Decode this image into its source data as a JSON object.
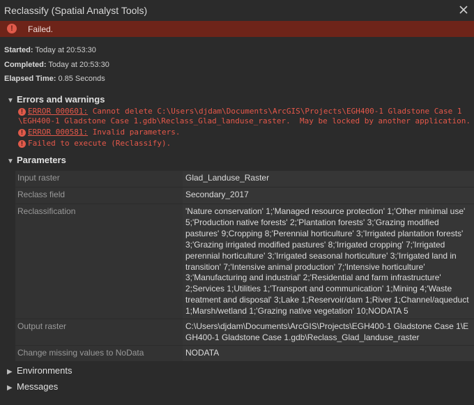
{
  "window": {
    "title": "Reclassify (Spatial Analyst Tools)"
  },
  "status": {
    "text": "Failed."
  },
  "info": {
    "started_label": "Started:",
    "started_value": "Today at 20:53:30",
    "completed_label": "Completed:",
    "completed_value": "Today at 20:53:30",
    "elapsed_label": "Elapsed Time:",
    "elapsed_value": "0.85 Seconds"
  },
  "errors": {
    "heading": "Errors and warnings",
    "messages": [
      {
        "code": "ERROR 000601:",
        "line1": " Cannot delete C:\\Users\\djdam\\Documents\\ArcGIS\\Projects\\EGH400-1 Gladstone Case 1",
        "line2": "\\EGH400-1 Gladstone Case 1.gdb\\Reclass_Glad_landuse_raster.  May be locked by another application."
      },
      {
        "code": "ERROR 000581:",
        "line1": " Invalid parameters."
      },
      {
        "text": "Failed to execute (Reclassify)."
      }
    ]
  },
  "parameters": {
    "heading": "Parameters",
    "rows": [
      {
        "key": "Input raster",
        "value": "Glad_Landuse_Raster"
      },
      {
        "key": "Reclass field",
        "value": "Secondary_2017"
      },
      {
        "key": "Reclassification",
        "value": "'Nature conservation' 1;'Managed resource protection' 1;'Other minimal use' 5;'Production native forests' 2;'Plantation forests' 3;'Grazing modified pastures' 9;Cropping 8;'Perennial horticulture' 3;'Irrigated plantation forests' 3;'Grazing irrigated modified pastures' 8;'Irrigated cropping' 7;'Irrigated perennial horticulture' 3;'Irrigated seasonal horticulture' 3;'Irrigated land in transition' 7;'Intensive animal production' 7;'Intensive horticulture' 3;'Manufacturing and industrial' 2;'Residential and farm infrastructure' 2;Services 1;Utilities 1;'Transport and communication' 1;Mining 4;'Waste treatment and disposal' 3;Lake 1;Reservoir/dam 1;River 1;Channel/aqueduct 1;Marsh/wetland 1;'Grazing native vegetation' 10;NODATA 5"
      },
      {
        "key": "Output raster",
        "value": "C:\\Users\\djdam\\Documents\\ArcGIS\\Projects\\EGH400-1 Gladstone Case 1\\EGH400-1 Gladstone Case 1.gdb\\Reclass_Glad_landuse_raster"
      },
      {
        "key": "Change missing values to NoData",
        "value": "NODATA"
      }
    ]
  },
  "sections": {
    "environments": "Environments",
    "messages": "Messages"
  },
  "colors": {
    "background": "#2b2b2b",
    "status_bar": "#6e2419",
    "error_text": "#e5584a"
  },
  "icons": {
    "close": "close-icon",
    "status": "error-icon",
    "chevron_down": "chevron-down-icon",
    "chevron_right": "chevron-right-icon"
  }
}
